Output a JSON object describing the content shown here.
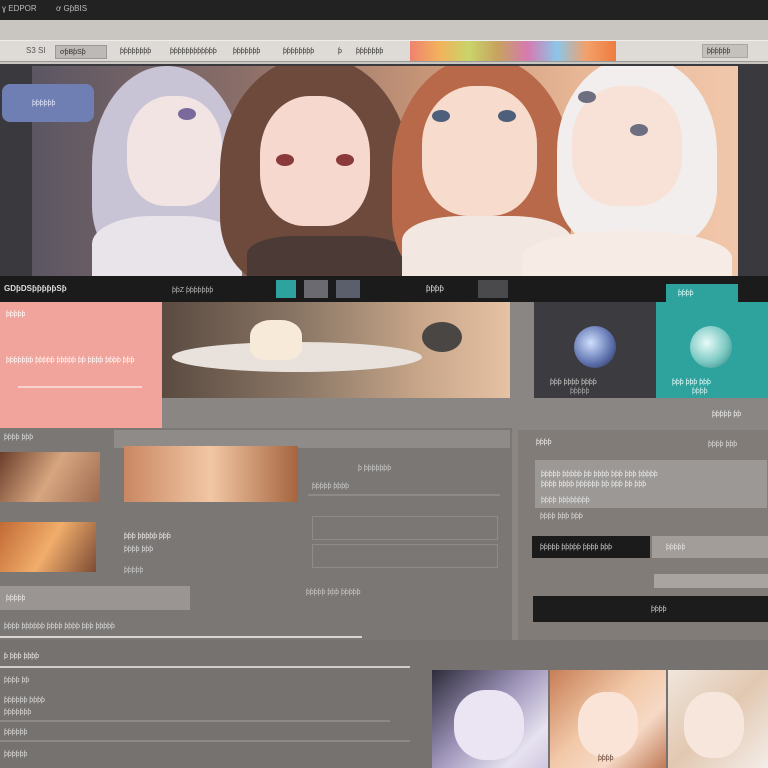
{
  "nav": {
    "top_left": "ɣ EDPOR",
    "top_center": "ơ GƥBIS",
    "logo": "S3 SI",
    "tab_active": "ơƥBƥSƥ",
    "items": [
      "ƥƥƥƥƥƥƥƥ",
      "ƥƥƥƥƥƥƥƥƥƥƥƥ",
      "ƥƥƥƥƥƥƥ",
      "ƥƥƥƥƥƥƥƥ",
      "ƥ",
      "ƥƥƥƥƥƥƥ"
    ],
    "search_label": "ƥƥƥƥƥƥ"
  },
  "hero": {
    "button_label": "ƥƥƥƥƥƥ",
    "strip_left": "GDƥDSƥƥƥƥƥSƥ",
    "strip_mid": "ƥƥZ ƥƥƥƥƥƥƥ",
    "strip_right": "ƥƥƥƥ",
    "strip_far": "ƥƥƥƥ"
  },
  "middle": {
    "pink_heading": "ƥƥƥƥƥ",
    "pink_line": "ƥƥƥƥƥƥƥ ƥƥƥƥƥ ƥƥƥƥƥ ƥƥ ƥƥƥƥ ƥƥƥƥ ƥƥƥ",
    "card1_caption": "ƥƥƥ ƥƥƥƥ ƥƥƥƥ",
    "card1_sub": "ƥƥƥƥƥ",
    "card2_caption": "ƥƥƥ ƥƥƥ ƥƥƥ",
    "card2_sub": "ƥƥƥƥ",
    "right_label": "ƥƥƥƥƥ ƥƥ"
  },
  "lower": {
    "section_label": "ƥƥƥƥ ƥƥƥ",
    "row_text_1": "ƥ ƥƥƥƥƥƥƥ",
    "row_text_2": "ƥƥƥƥƥ ƥƥƥƥ",
    "item_title": "ƥƥƥ ƥƥƥƥƥ ƥƥƥ",
    "item_sub": "ƥƥƥƥ ƥƥƥ",
    "item_more": "ƥƥƥƥƥ",
    "pill_label": "ƥƥƥƥƥ",
    "bar_text": "ƥƥƥƥ ƥƥƥƥƥƥ ƥƥƥƥ ƥƥƥƥ ƥƥƥ ƥƥƥƥƥ",
    "link_text": "ƥƥƥƥƥ ƥƥƥ ƥƥƥƥƥ"
  },
  "sidebar": {
    "title": "ƥƥƥƥ",
    "count": "ƥƥƥƥ ƥƥƥ",
    "body_1": "ƥƥƥƥƥ ƥƥƥƥƥ ƥƥ ƥƥƥƥ ƥƥƥ ƥƥƥ ƥƥƥƥƥ",
    "body_2": "ƥƥƥƥ ƥƥƥƥ ƥƥƥƥƥƥ ƥƥ ƥƥƥ ƥƥ ƥƥƥ",
    "body_3": "ƥƥƥƥ ƥƥƥƥƥƥƥƥ",
    "meta": "ƥƥƥƥ ƥƥƥ ƥƥƥ",
    "btn1_label": "ƥƥƥƥƥ ƥƥƥƥƥ ƥƥƥƥ ƥƥƥ",
    "field_placeholder": "ƥƥƥƥƥ",
    "btn2_label": "ƥƥƥƥ"
  },
  "bottom": {
    "heading": "ƥ ƥƥƥ ƥƥƥƥ",
    "line_1": "ƥƥƥƥ ƥƥ",
    "line_2": "ƥƥƥƥƥƥ ƥƥƥƥ",
    "line_3": "ƥƥƥƥƥƥƥ",
    "line_4": "ƥƥƥƥƥƥ",
    "line_5": "ƥƥƥƥƥƥ",
    "card_caption": "ƥƥƥƥ"
  },
  "colors": {
    "accent_pink": "#f1a49b",
    "accent_teal": "#2ea39d",
    "accent_blue": "#6f7eb3",
    "dark": "#1c1b1c"
  }
}
